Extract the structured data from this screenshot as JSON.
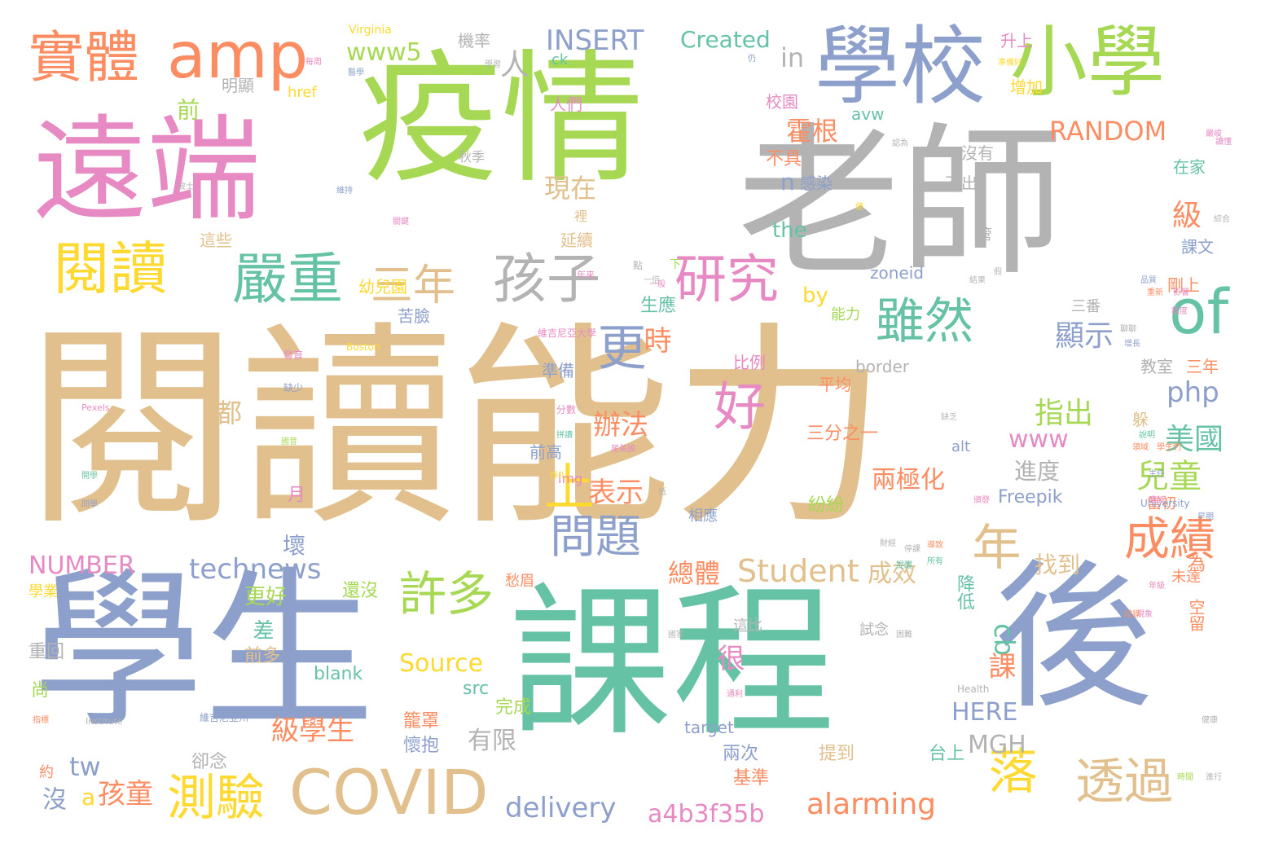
{
  "palette": {
    "tan": "#e2c08d",
    "blue": "#8da0cb",
    "green": "#66c2a5",
    "lime": "#a6d854",
    "pink": "#e78ac3",
    "orange": "#fc8d62",
    "gray": "#b3b3b3",
    "yellow": "#ffd92f"
  },
  "words": [
    {
      "text": "閱讀能力",
      "color": "#e2c08d"
    },
    {
      "text": "疫情",
      "color": "#a6d854"
    },
    {
      "text": "老師",
      "color": "#b3b3b3"
    },
    {
      "text": "學生",
      "color": "#8da0cb"
    },
    {
      "text": "課程",
      "color": "#66c2a5"
    },
    {
      "text": "後",
      "color": "#8da0cb"
    },
    {
      "text": "遠端",
      "color": "#e78ac3"
    },
    {
      "text": "學校",
      "color": "#8da0cb"
    },
    {
      "text": "小學",
      "color": "#a6d854"
    },
    {
      "text": "amp",
      "color": "#fc8d62"
    },
    {
      "text": "實體",
      "color": "#fc8d62"
    },
    {
      "text": "閱讀",
      "color": "#ffd92f"
    },
    {
      "text": "嚴重",
      "color": "#66c2a5"
    },
    {
      "text": "孩子",
      "color": "#b3b3b3"
    },
    {
      "text": "研究",
      "color": "#e78ac3"
    },
    {
      "text": "of",
      "color": "#66c2a5"
    },
    {
      "text": "三年",
      "color": "#e2c08d"
    },
    {
      "text": "好",
      "color": "#e78ac3"
    },
    {
      "text": "更",
      "color": "#8da0cb"
    },
    {
      "text": "上",
      "color": "#ffd92f"
    },
    {
      "text": "雖然",
      "color": "#66c2a5"
    },
    {
      "text": "年",
      "color": "#e2c08d"
    },
    {
      "text": "COVID",
      "color": "#e2c08d"
    },
    {
      "text": "透過",
      "color": "#e2c08d"
    },
    {
      "text": "測驗",
      "color": "#ffd92f"
    },
    {
      "text": "許多",
      "color": "#a6d854"
    },
    {
      "text": "問題",
      "color": "#8da0cb"
    },
    {
      "text": "成績",
      "color": "#fc8d62"
    },
    {
      "text": "落",
      "color": "#ffd92f"
    },
    {
      "text": "Student",
      "color": "#e2c08d"
    },
    {
      "text": "technews",
      "color": "#8da0cb"
    },
    {
      "text": "alarming",
      "color": "#fc8d62"
    },
    {
      "text": "a4b3f35b",
      "color": "#e78ac3"
    },
    {
      "text": "delivery",
      "color": "#8da0cb"
    },
    {
      "text": "Source",
      "color": "#ffd92f"
    },
    {
      "text": "INSERT",
      "color": "#8da0cb"
    },
    {
      "text": "Created",
      "color": "#66c2a5"
    },
    {
      "text": "www5",
      "color": "#a6d854"
    },
    {
      "text": "in",
      "color": "#b3b3b3"
    },
    {
      "text": "RANDOM",
      "color": "#fc8d62"
    },
    {
      "text": "NUMBER",
      "color": "#e78ac3"
    },
    {
      "text": "HERE",
      "color": "#8da0cb"
    },
    {
      "text": "MGH",
      "color": "#b3b3b3"
    },
    {
      "text": "php",
      "color": "#8da0cb"
    },
    {
      "text": "www",
      "color": "#e78ac3"
    },
    {
      "text": "Freepik",
      "color": "#8da0cb"
    },
    {
      "text": "the",
      "color": "#66c2a5"
    },
    {
      "text": "by",
      "color": "#ffd92f"
    },
    {
      "text": "cb",
      "color": "#66c2a5"
    },
    {
      "text": "tw",
      "color": "#8da0cb"
    },
    {
      "text": "美國",
      "color": "#66c2a5"
    },
    {
      "text": "兒童",
      "color": "#a6d854"
    },
    {
      "text": "指出",
      "color": "#a6d854"
    },
    {
      "text": "顯示",
      "color": "#8da0cb"
    },
    {
      "text": "表示",
      "color": "#fc8d62"
    },
    {
      "text": "辦法",
      "color": "#fc8d62"
    },
    {
      "text": "霍根",
      "color": "#fc8d62"
    },
    {
      "text": "現在",
      "color": "#e2c08d"
    },
    {
      "text": "級學生",
      "color": "#fc8d62"
    },
    {
      "text": "有限",
      "color": "#b3b3b3"
    },
    {
      "text": "孩童",
      "color": "#fc8d62"
    },
    {
      "text": "總體",
      "color": "#fc8d62"
    },
    {
      "text": "成效",
      "color": "#e2c08d"
    },
    {
      "text": "找到",
      "color": "#e2c08d"
    },
    {
      "text": "兩極化",
      "color": "#fc8d62"
    },
    {
      "text": "進度",
      "color": "#b3b3b3"
    },
    {
      "text": "級",
      "color": "#fc8d62"
    },
    {
      "text": "時",
      "color": "#fc8d62"
    },
    {
      "text": "都",
      "color": "#e2c08d"
    },
    {
      "text": "很",
      "color": "#e78ac3"
    },
    {
      "text": "課",
      "color": "#fc8d62"
    },
    {
      "text": "前",
      "color": "#a6d854"
    },
    {
      "text": "人",
      "color": "#b3b3b3"
    },
    {
      "text": "沒",
      "color": "#8da0cb"
    },
    {
      "text": "a",
      "color": "#ffd92f"
    },
    {
      "text": "n",
      "color": "#8da0cb"
    },
    {
      "text": "壞",
      "color": "#8da0cb"
    },
    {
      "text": "更好",
      "color": "#a6d854"
    },
    {
      "text": "差",
      "color": "#66c2a5"
    },
    {
      "text": "前多",
      "color": "#e2c08d"
    },
    {
      "text": "blank",
      "color": "#66c2a5"
    },
    {
      "text": "src",
      "color": "#66c2a5"
    },
    {
      "text": "完成",
      "color": "#a6d854"
    },
    {
      "text": "籠罩",
      "color": "#fc8d62"
    },
    {
      "text": "懷抱",
      "color": "#8da0cb"
    },
    {
      "text": "target",
      "color": "#8da0cb"
    },
    {
      "text": "兩次",
      "color": "#8da0cb"
    },
    {
      "text": "基準",
      "color": "#fc8d62"
    },
    {
      "text": "提到",
      "color": "#e2c08d"
    },
    {
      "text": "台上",
      "color": "#66c2a5"
    },
    {
      "text": "卻念",
      "color": "#b3b3b3"
    },
    {
      "text": "約",
      "color": "#fc8d62"
    },
    {
      "text": "尚",
      "color": "#a6d854"
    },
    {
      "text": "重回",
      "color": "#b3b3b3"
    },
    {
      "text": "學業",
      "color": "#ffd92f"
    },
    {
      "text": "月",
      "color": "#e78ac3"
    },
    {
      "text": "還沒",
      "color": "#a6d854"
    },
    {
      "text": "愁眉",
      "color": "#fc8d62"
    },
    {
      "text": "相應",
      "color": "#8da0cb"
    },
    {
      "text": "img",
      "color": "#e78ac3"
    },
    {
      "text": "前高",
      "color": "#8da0cb"
    },
    {
      "text": "準備",
      "color": "#8da0cb"
    },
    {
      "text": "比例",
      "color": "#e78ac3"
    },
    {
      "text": "苦臉",
      "color": "#8da0cb"
    },
    {
      "text": "生應",
      "color": "#66c2a5"
    },
    {
      "text": "延續",
      "color": "#e2c08d"
    },
    {
      "text": "人們",
      "color": "#e78ac3"
    },
    {
      "text": "幼兒園",
      "color": "#ffd92f"
    },
    {
      "text": "這些",
      "color": "#e2c08d"
    },
    {
      "text": "秋季",
      "color": "#b3b3b3"
    },
    {
      "text": "明顯",
      "color": "#b3b3b3"
    },
    {
      "text": "機率",
      "color": "#b3b3b3"
    },
    {
      "text": "升上",
      "color": "#e78ac3"
    },
    {
      "text": "增加",
      "color": "#ffd92f"
    },
    {
      "text": "校園",
      "color": "#e78ac3"
    },
    {
      "text": "不具",
      "color": "#fc8d62"
    },
    {
      "text": "感染",
      "color": "#8da0cb"
    },
    {
      "text": "不出",
      "color": "#b3b3b3"
    },
    {
      "text": "沒有",
      "color": "#b3b3b3"
    },
    {
      "text": "在家",
      "color": "#66c2a5"
    },
    {
      "text": "課文",
      "color": "#8da0cb"
    },
    {
      "text": "剛上",
      "color": "#fc8d62"
    },
    {
      "text": "教室",
      "color": "#b3b3b3"
    },
    {
      "text": "三年",
      "color": "#fc8d62"
    },
    {
      "text": "三番",
      "color": "#b3b3b3"
    },
    {
      "text": "平均",
      "color": "#fc8d62"
    },
    {
      "text": "紛紛",
      "color": "#a6d854"
    },
    {
      "text": "三分之一",
      "color": "#fc8d62"
    },
    {
      "text": "降低",
      "color": "#66c2a5"
    },
    {
      "text": "為",
      "color": "#fc8d62"
    },
    {
      "text": "空留",
      "color": "#fc8d62"
    },
    {
      "text": "未達",
      "color": "#fc8d62"
    },
    {
      "text": "當初",
      "color": "#fc8d62"
    },
    {
      "text": "躲",
      "color": "#e2c08d"
    },
    {
      "text": "這比",
      "color": "#b3b3b3"
    },
    {
      "text": "試念",
      "color": "#b3b3b3"
    },
    {
      "text": "avw",
      "color": "#66c2a5"
    },
    {
      "text": "zoneid",
      "color": "#8da0cb"
    },
    {
      "text": "border",
      "color": "#b3b3b3"
    },
    {
      "text": "alt",
      "color": "#8da0cb"
    },
    {
      "text": "href",
      "color": "#ffd92f"
    },
    {
      "text": "ck",
      "color": "#66c2a5"
    },
    {
      "text": "Virginia",
      "color": "#ffd92f"
    },
    {
      "text": "能力",
      "color": "#a6d854"
    },
    {
      "text": "裡",
      "color": "#e2c08d"
    },
    {
      "text": "管",
      "color": "#b3b3b3"
    },
    {
      "text": "維吉尼亞大學",
      "color": "#e78ac3"
    },
    {
      "text": "維吉尼亞州",
      "color": "#8da0cb"
    },
    {
      "text": "Boston",
      "color": "#ffd92f"
    },
    {
      "text": "Pexels",
      "color": "#e78ac3"
    },
    {
      "text": "University",
      "color": "#8da0cb"
    },
    {
      "text": "Institute",
      "color": "#b3b3b3"
    },
    {
      "text": "Health",
      "color": "#b3b3b3"
    },
    {
      "text": "分數",
      "color": "#e78ac3"
    },
    {
      "text": "下",
      "color": "#a6d854"
    },
    {
      "text": "一倍",
      "color": "#b3b3b3"
    },
    {
      "text": "年來",
      "color": "#e78ac3"
    },
    {
      "text": "點",
      "color": "#b3b3b3"
    },
    {
      "text": "尾美國",
      "color": "#e78ac3"
    },
    {
      "text": "缺少",
      "color": "#8da0cb"
    },
    {
      "text": "發音",
      "color": "#e78ac3"
    },
    {
      "text": "國音",
      "color": "#a6d854"
    },
    {
      "text": "開學",
      "color": "#66c2a5"
    },
    {
      "text": "同學",
      "color": "#8da0cb"
    },
    {
      "text": "掙扎",
      "color": "#ffd92f"
    },
    {
      "text": "拼讀",
      "color": "#66c2a5"
    },
    {
      "text": "缺乏",
      "color": "#b3b3b3"
    },
    {
      "text": "每周",
      "color": "#e78ac3"
    },
    {
      "text": "醫學",
      "color": "#8da0cb"
    },
    {
      "text": "應該",
      "color": "#e78ac3"
    },
    {
      "text": "維持",
      "color": "#8da0cb"
    },
    {
      "text": "關鍵",
      "color": "#e78ac3"
    },
    {
      "text": "認為",
      "color": "#b3b3b3"
    },
    {
      "text": "準備好",
      "color": "#ffd92f"
    },
    {
      "text": "學習",
      "color": "#b3b3b3"
    },
    {
      "text": "仍",
      "color": "#8da0cb"
    },
    {
      "text": "一般",
      "color": "#e78ac3"
    },
    {
      "text": "時間",
      "color": "#a6d854"
    },
    {
      "text": "讀懂",
      "color": "#e78ac3"
    },
    {
      "text": "健康",
      "color": "#b3b3b3"
    },
    {
      "text": "聊聊",
      "color": "#b3b3b3"
    },
    {
      "text": "影響",
      "color": "#e78ac3"
    },
    {
      "text": "主任",
      "color": "#8da0cb"
    },
    {
      "text": "學生們",
      "color": "#fc8d62"
    },
    {
      "text": "波士",
      "color": "#b3b3b3"
    },
    {
      "text": "綜合",
      "color": "#b3b3b3"
    },
    {
      "text": "指標",
      "color": "#fc8d62"
    },
    {
      "text": "品質",
      "color": "#8da0cb"
    },
    {
      "text": "重新",
      "color": "#fc8d62"
    },
    {
      "text": "假",
      "color": "#b3b3b3"
    },
    {
      "text": "程度",
      "color": "#e78ac3"
    },
    {
      "text": "增長",
      "color": "#8da0cb"
    },
    {
      "text": "停課",
      "color": "#b3b3b3"
    },
    {
      "text": "導致",
      "color": "#fc8d62"
    },
    {
      "text": "便",
      "color": "#ffd92f"
    },
    {
      "text": "頒發",
      "color": "#e78ac3"
    },
    {
      "text": "現象",
      "color": "#e78ac3"
    },
    {
      "text": "困難",
      "color": "#b3b3b3"
    },
    {
      "text": "領域",
      "color": "#fc8d62"
    },
    {
      "text": "進行",
      "color": "#b3b3b3"
    },
    {
      "text": "財經",
      "color": "#b3b3b3"
    },
    {
      "text": "早期",
      "color": "#8da0cb"
    },
    {
      "text": "提醒",
      "color": "#66c2a5"
    },
    {
      "text": "年級",
      "color": "#e78ac3"
    },
    {
      "text": "低",
      "color": "#b3b3b3"
    },
    {
      "text": "通利",
      "color": "#e78ac3"
    },
    {
      "text": "所有",
      "color": "#66c2a5"
    },
    {
      "text": "國家",
      "color": "#b3b3b3"
    },
    {
      "text": "嚴峻",
      "color": "#e78ac3"
    },
    {
      "text": "記錄",
      "color": "#fc8d62"
    },
    {
      "text": "結果",
      "color": "#b3b3b3"
    },
    {
      "text": "說明",
      "color": "#66c2a5"
    }
  ]
}
